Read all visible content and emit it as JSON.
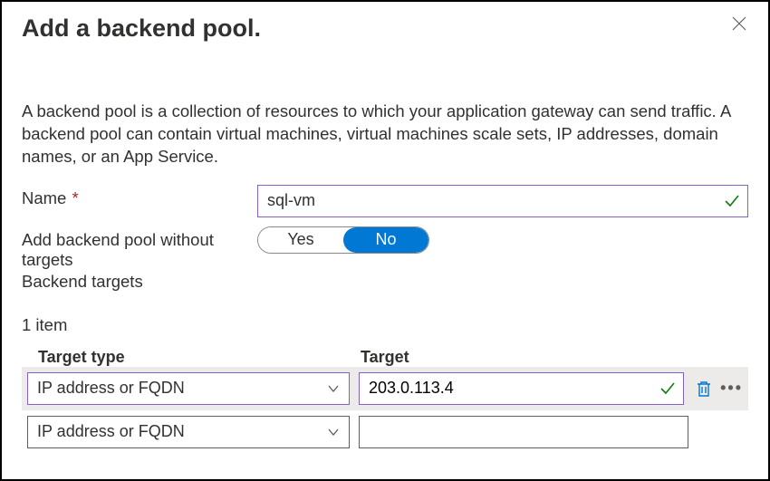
{
  "header": {
    "title": "Add a backend pool."
  },
  "description": "A backend pool is a collection of resources to which your application gateway can send traffic. A backend pool can contain virtual machines, virtual machines scale sets, IP addresses, domain names, or an App Service.",
  "form": {
    "name_label": "Name",
    "name_value": "sql-vm",
    "add_without_targets_label": "Add backend pool without targets",
    "toggle_yes": "Yes",
    "toggle_no": "No",
    "toggle_selected": "No",
    "backend_targets_label": "Backend targets",
    "item_count": "1 item"
  },
  "table": {
    "col_type": "Target type",
    "col_target": "Target",
    "rows": [
      {
        "type": "IP address or FQDN",
        "target": "203.0.113.4",
        "valid": true,
        "active": true
      },
      {
        "type": "IP address or FQDN",
        "target": "",
        "valid": false,
        "active": false
      }
    ]
  }
}
